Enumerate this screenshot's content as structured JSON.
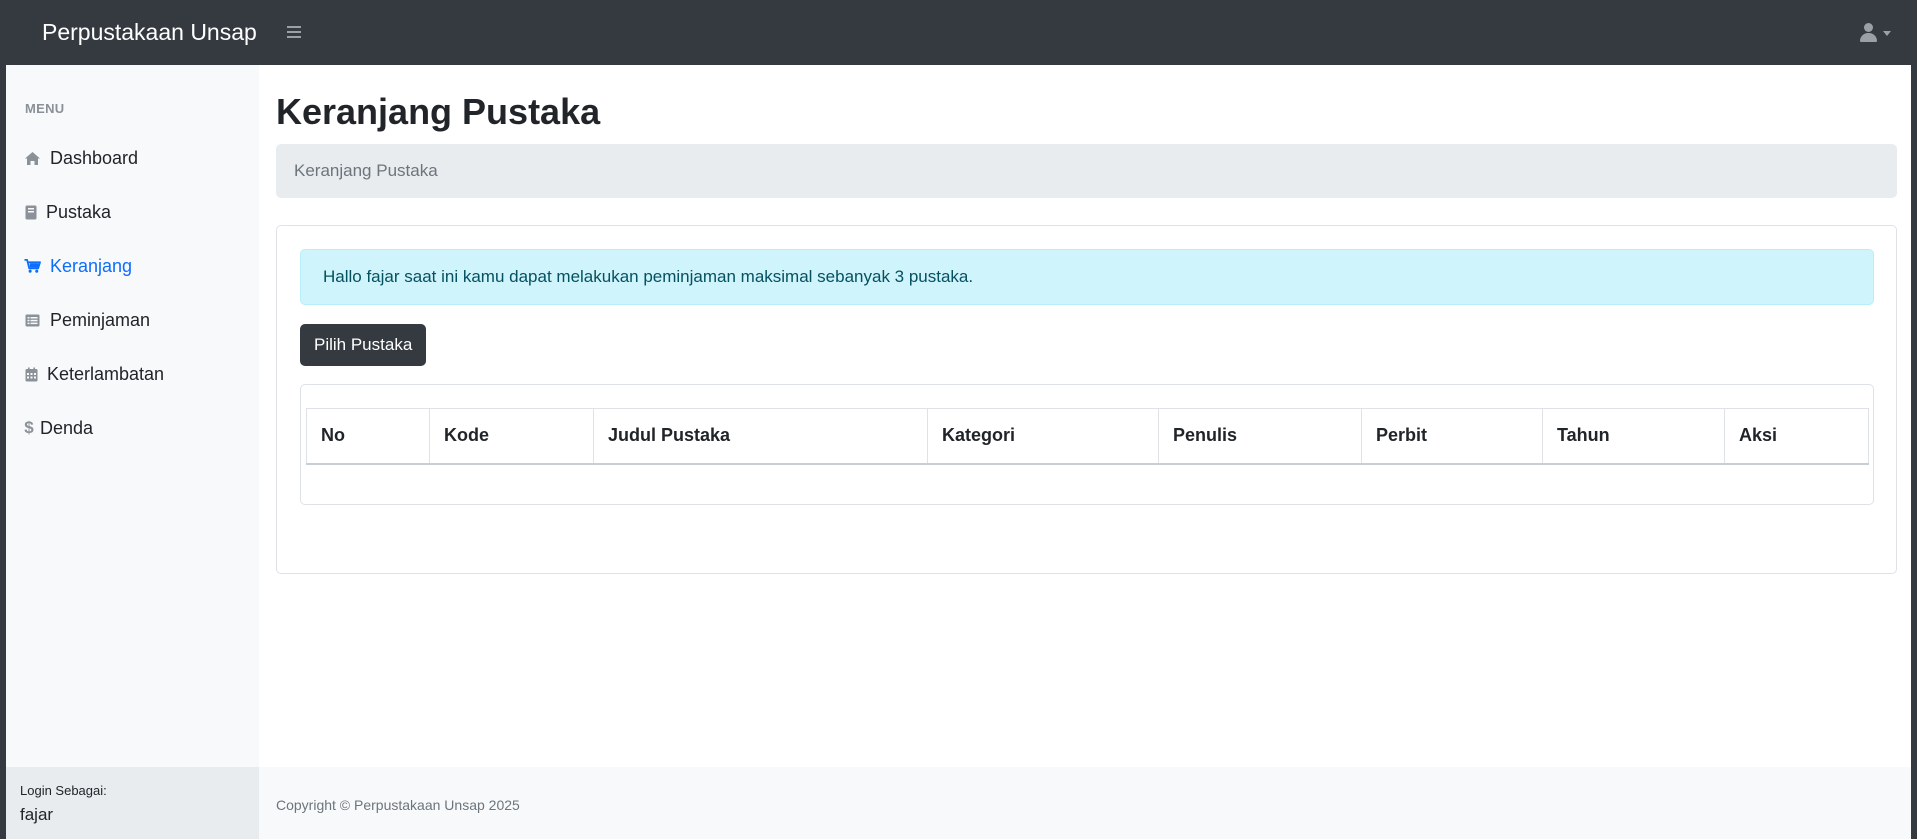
{
  "navbar": {
    "brand": "Perpustakaan Unsap",
    "toggle_icon": "bars-icon",
    "user_icon": "user-icon"
  },
  "sidebar": {
    "heading": "MENU",
    "items": [
      {
        "label": "Dashboard",
        "icon": "home-icon",
        "active": false
      },
      {
        "label": "Pustaka",
        "icon": "book-icon",
        "active": false
      },
      {
        "label": "Keranjang",
        "icon": "cart-icon",
        "active": true
      },
      {
        "label": "Peminjaman",
        "icon": "list-icon",
        "active": false
      },
      {
        "label": "Keterlambatan",
        "icon": "calendar-icon",
        "active": false
      },
      {
        "label": "Denda",
        "icon": "dollar-icon",
        "active": false
      }
    ],
    "footer": {
      "label": "Login Sebagai:",
      "username": "fajar"
    }
  },
  "main": {
    "title": "Keranjang Pustaka",
    "breadcrumb": "Keranjang Pustaka",
    "alert": "Hallo fajar saat ini kamu dapat melakukan peminjaman maksimal sebanyak 3 pustaka.",
    "button_label": "Pilih Pustaka",
    "table": {
      "headers": [
        "No",
        "Kode",
        "Judul Pustaka",
        "Kategori",
        "Penulis",
        "Perbit",
        "Tahun",
        "Aksi"
      ],
      "rows": []
    }
  },
  "footer": {
    "copyright": "Copyright © Perpustakaan Unsap 2025"
  },
  "colors": {
    "navbar_bg": "#343a40",
    "active_link": "#0d6efd",
    "alert_bg": "#cff4fc",
    "alert_text": "#055160",
    "breadcrumb_bg": "#e9ecef"
  }
}
